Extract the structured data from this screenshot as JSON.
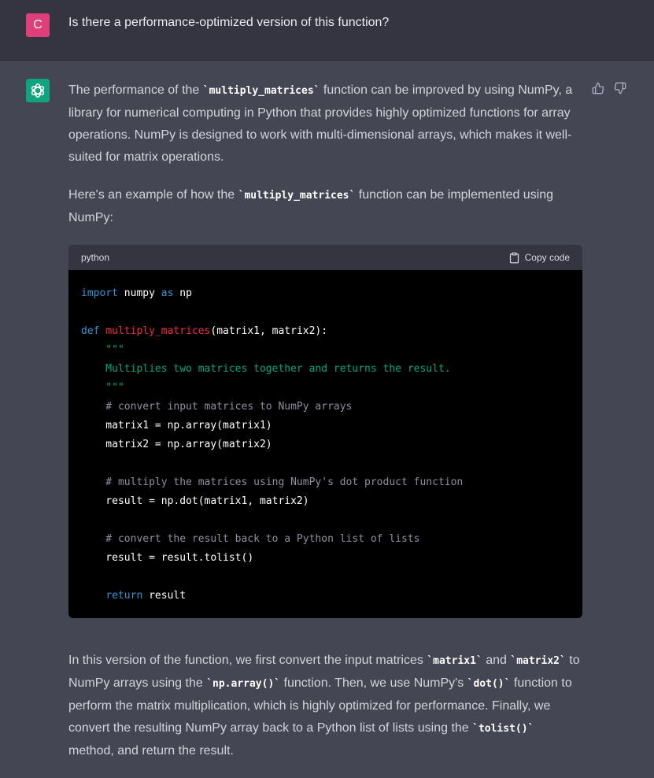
{
  "user": {
    "avatar_letter": "C",
    "message": "Is there a performance-optimized version of this function?"
  },
  "assistant": {
    "p1": {
      "a": "The performance of the ",
      "code": "`multiply_matrices`",
      "b": " function can be improved by using NumPy, a library for numerical computing in Python that provides highly optimized functions for array operations. NumPy is designed to work with multi-dimensional arrays, which makes it well-suited for matrix operations."
    },
    "p2": {
      "a": "Here's an example of how the ",
      "code": "`multiply_matrices`",
      "b": " function can be implemented using NumPy:"
    },
    "codeblock": {
      "language": "python",
      "copy_label": "Copy code",
      "lines": {
        "l1a": "import",
        "l1b": " numpy ",
        "l1c": "as",
        "l1d": " np",
        "l3a": "def",
        "l3b": " ",
        "l3c": "multiply_matrices",
        "l3d": "(matrix1, matrix2):",
        "l4": "    \"\"\"",
        "l5": "    Multiplies two matrices together and returns the result.",
        "l6": "    \"\"\"",
        "l7": "    # convert input matrices to NumPy arrays",
        "l8": "    matrix1 = np.array(matrix1)",
        "l9": "    matrix2 = np.array(matrix2)",
        "l11": "    # multiply the matrices using NumPy's dot product function",
        "l12": "    result = np.dot(matrix1, matrix2)",
        "l14": "    # convert the result back to a Python list of lists",
        "l15": "    result = result.tolist()",
        "l17a": "    ",
        "l17b": "return",
        "l17c": " result"
      }
    },
    "p3": {
      "a": "In this version of the function, we first convert the input matrices ",
      "c1": "`matrix1`",
      "b": " and ",
      "c2": "`matrix2`",
      "c": " to NumPy arrays using the ",
      "c3": "`np.array()`",
      "d": " function. Then, we use NumPy's ",
      "c4": "`dot()`",
      "e": " function to perform the matrix multiplication, which is highly optimized for performance. Finally, we convert the resulting NumPy array back to a Python list of lists using the ",
      "c5": "`tolist()`",
      "f": " method, and return the result."
    }
  },
  "colors": {
    "user_bg": "#343541",
    "assistant_bg": "#444654",
    "user_avatar": "#e0407a",
    "bot_avatar": "#10a37f"
  }
}
